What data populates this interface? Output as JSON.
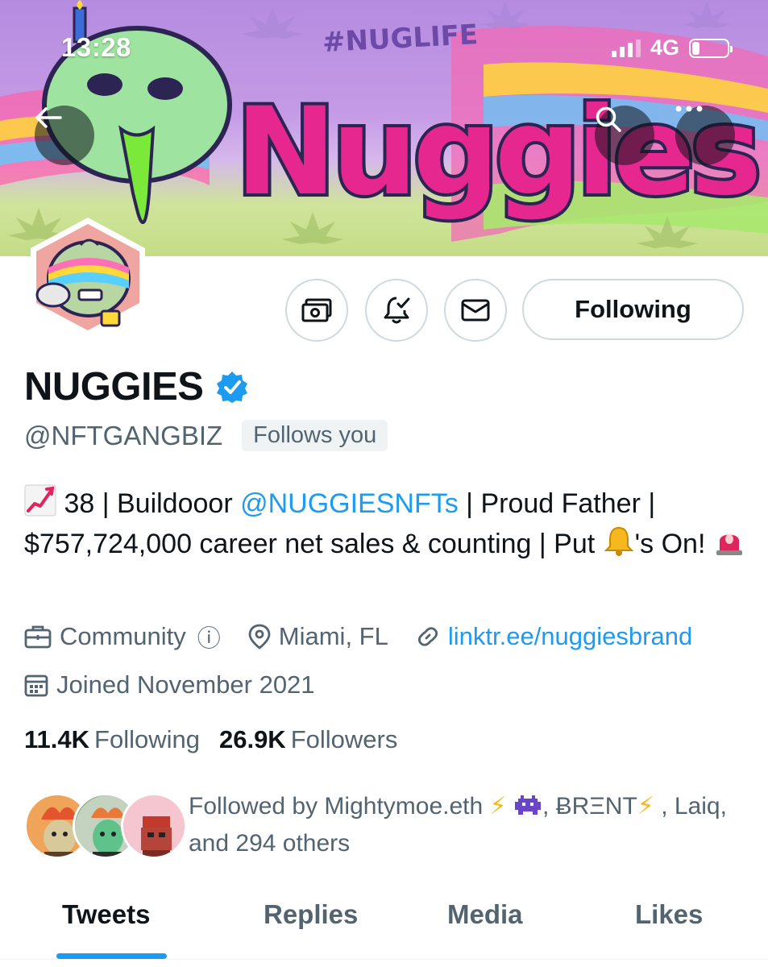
{
  "status_bar": {
    "time": "13:28",
    "network": "4G"
  },
  "banner": {
    "hashtag": "#NUGLIFE",
    "logo_text": "Nuggies"
  },
  "actions": {
    "following_label": "Following"
  },
  "profile": {
    "name": "NUGGIES",
    "handle": "@NFTGANGBIZ",
    "follows_you_label": "Follows you",
    "bio": {
      "part1": " 38 | Buildooor ",
      "mention": "@NUGGIESNFTs",
      "part2": " | Proud Father | $757,724,000 career net sales & counting | Put ",
      "part3": "'s On! "
    },
    "category": "Community",
    "location": "Miami, FL",
    "website": "linktr.ee/nuggiesbrand",
    "joined": "Joined November 2021"
  },
  "stats": {
    "following_count": "11.4K",
    "following_label": "Following",
    "followers_count": "26.9K",
    "followers_label": "Followers"
  },
  "followed_by": {
    "part1": "Followed by Mightymoe.eth ",
    "part2": ", ",
    "brent": "ɃRΞNT",
    "part3": " , Laiq, and 294 others"
  },
  "tabs": [
    {
      "label": "Tweets",
      "active": true
    },
    {
      "label": "Replies",
      "active": false
    },
    {
      "label": "Media",
      "active": false
    },
    {
      "label": "Likes",
      "active": false
    }
  ],
  "colors": {
    "accent": "#1d9bf0",
    "secondary_text": "#536471",
    "primary_text": "#0f1419",
    "border": "#cfd9de"
  },
  "icons": [
    "back-arrow-icon",
    "search-icon",
    "more-icon",
    "tip-jar-icon",
    "bell-check-icon",
    "mail-icon",
    "verified-badge-icon",
    "briefcase-icon",
    "info-icon",
    "location-pin-icon",
    "link-icon",
    "calendar-icon",
    "chart-increasing-emoji",
    "bell-emoji",
    "siren-emoji",
    "lightning-emoji",
    "alien-monster-emoji"
  ]
}
